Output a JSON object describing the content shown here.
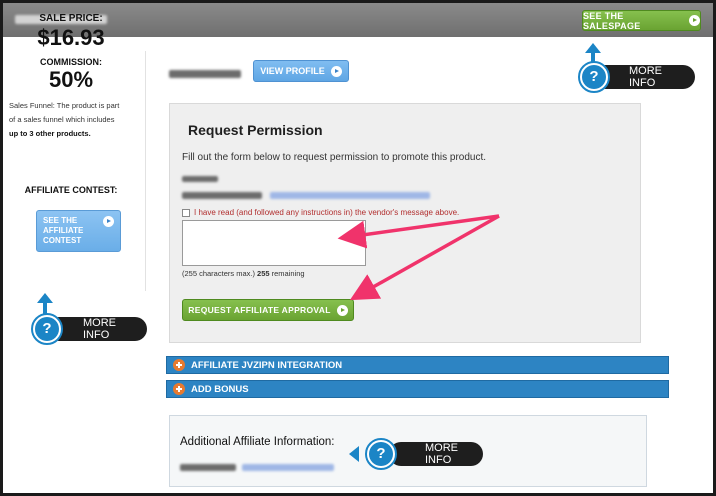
{
  "header": {
    "salespage_button": "SEE THE SALESPAGE"
  },
  "sidebar": {
    "sale_price_label": "SALE PRICE:",
    "sale_price_value": "$16.93",
    "commission_label": "COMMISSION:",
    "commission_value": "50%",
    "funnel_text_1": "Sales Funnel: The product is part of a sales funnel which includes ",
    "funnel_text_bold": "up to 3 other products.",
    "contest_label": "AFFILIATE CONTEST:",
    "contest_button": "SEE THE AFFILIATE CONTEST",
    "more_info": "MORE INFO"
  },
  "vendor": {
    "view_profile_button": "VIEW PROFILE",
    "more_info": "MORE INFO"
  },
  "request_permission": {
    "heading": "Request Permission",
    "instructions": "Fill out the form below to request permission to promote this product.",
    "checkbox_label": "I have read (and followed any instructions in) the vendor's message above.",
    "chars_prefix": "(255 characters max.) ",
    "chars_count": "255",
    "chars_suffix": " remaining",
    "submit_button": "REQUEST AFFILIATE APPROVAL"
  },
  "sections": [
    {
      "label": "AFFILIATE JVZIPN INTEGRATION"
    },
    {
      "label": "ADD BONUS"
    }
  ],
  "additional_info": {
    "label": "Additional Affiliate Information:",
    "more_info": "MORE INFO"
  },
  "colors": {
    "green_button": "#6aa332",
    "blue_button": "#5fa6e4",
    "section_bar": "#2d84c3",
    "badge_blue": "#1b85c6",
    "annotation_arrow": "#f0336b"
  }
}
